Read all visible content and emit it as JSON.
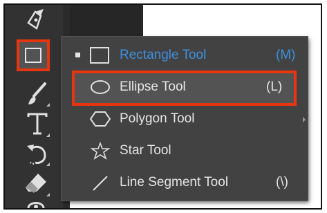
{
  "flyout": {
    "items": [
      {
        "label": "Rectangle Tool",
        "key": "(M)",
        "icon": "rectangle-icon",
        "active": true
      },
      {
        "label": "Ellipse Tool",
        "key": "(L)",
        "icon": "ellipse-icon",
        "active": false
      },
      {
        "label": "Polygon Tool",
        "key": "",
        "icon": "polygon-icon",
        "active": false
      },
      {
        "label": "Star Tool",
        "key": "",
        "icon": "star-icon",
        "active": false
      },
      {
        "label": "Line Segment Tool",
        "key": "(\\)",
        "icon": "line-segment-icon",
        "active": false
      }
    ]
  },
  "colors": {
    "accent_label": "#3d8fe0",
    "highlight": "#e8350f",
    "toolbar_bg": "#323232",
    "flyout_bg": "#424242"
  }
}
